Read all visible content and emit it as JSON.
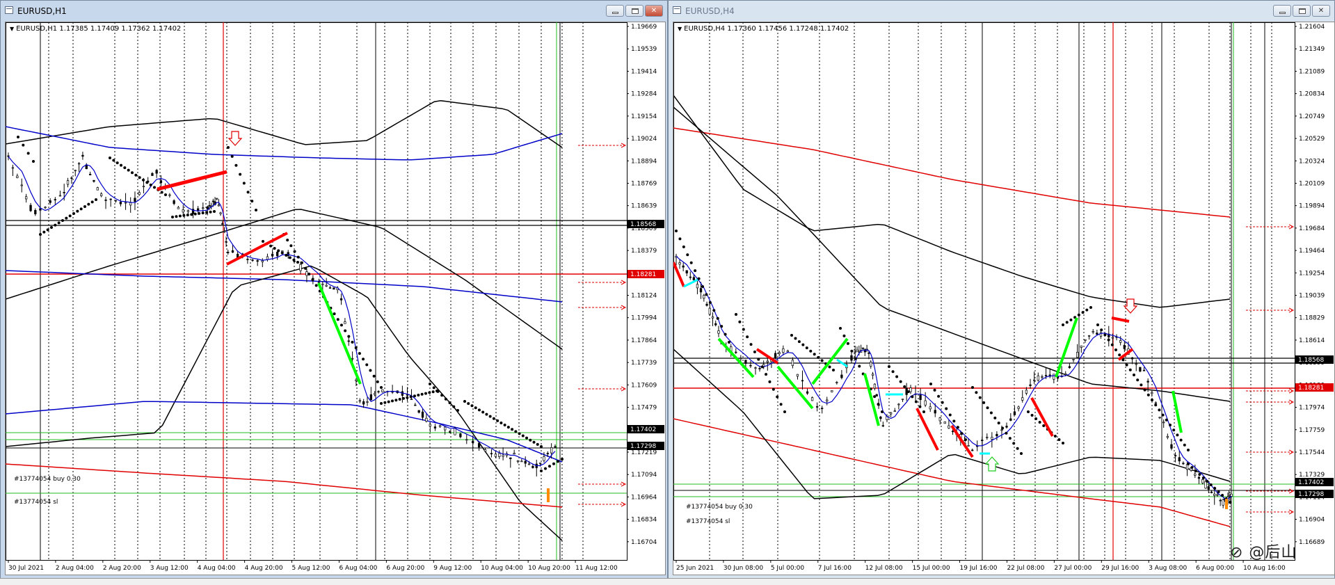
{
  "windows": [
    {
      "id": "left",
      "title": "EURUSD,H1",
      "info_text": "EURUSD,H1  1.17385 1.17409 1.17362 1.17402",
      "price_labels": [
        "1.19669",
        "1.19539",
        "1.19414",
        "1.19284",
        "1.19154",
        "1.19024",
        "1.18894",
        "1.18769",
        "1.18639",
        "1.18509",
        "1.18379",
        "1.18249",
        "1.18124",
        "1.17994",
        "1.17864",
        "1.17739",
        "1.17609",
        "1.17479",
        "1.17349",
        "1.17219",
        "1.17094",
        "1.16964",
        "1.16834",
        "1.16704"
      ],
      "time_labels": [
        "30 Jul 2021",
        "2 Aug 04:00",
        "2 Aug 20:00",
        "3 Aug 12:00",
        "4 Aug 04:00",
        "4 Aug 20:00",
        "5 Aug 12:00",
        "6 Aug 04:00",
        "6 Aug 20:00",
        "9 Aug 12:00",
        "10 Aug 04:00",
        "10 Aug 20:00",
        "11 Aug 12:00"
      ],
      "price_badges": [
        {
          "text": "1.18568",
          "color": "#000000",
          "text_color": "#ffffff"
        },
        {
          "text": "1.18281",
          "color": "#e00000",
          "text_color": "#ffffff"
        },
        {
          "text": "1.17402",
          "color": "#000000",
          "text_color": "#ffffff"
        },
        {
          "text": "1.17298",
          "color": "#000000",
          "text_color": "#ffffff"
        }
      ],
      "order_labels": [
        "#13774054 buy 0.30",
        "#13774054 sl"
      ],
      "state": "active"
    },
    {
      "id": "right",
      "title": "EURUSD,H4",
      "info_text": "EURUSD,H4  1.17360 1.17456 1.17248 1.17402",
      "price_labels": [
        "1.21604",
        "1.21349",
        "1.21089",
        "1.20834",
        "1.20749",
        "1.20529",
        "1.20324",
        "1.20109",
        "1.19894",
        "1.19684",
        "1.19464",
        "1.19254",
        "1.19039",
        "1.18829",
        "1.18614",
        "1.18399",
        "1.18189",
        "1.17974",
        "1.17759",
        "1.17544",
        "1.17329",
        "1.17114",
        "1.16904",
        "1.16689"
      ],
      "time_labels": [
        "25 Jun 2021",
        "30 Jun 08:00",
        "5 Jul 00:00",
        "7 Jul 16:00",
        "12 Jul 08:00",
        "15 Jul 00:00",
        "19 Jul 16:00",
        "22 Jul 08:00",
        "27 Jul 00:00",
        "29 Jul 16:00",
        "3 Aug 08:00",
        "6 Aug 00:00",
        "10 Aug 16:00"
      ],
      "price_badges": [
        {
          "text": "1.18568",
          "color": "#000000",
          "text_color": "#ffffff"
        },
        {
          "text": "1.18281",
          "color": "#e00000",
          "text_color": "#ffffff"
        },
        {
          "text": "1.17402",
          "color": "#000000",
          "text_color": "#ffffff"
        },
        {
          "text": "1.17298",
          "color": "#000000",
          "text_color": "#ffffff"
        }
      ],
      "order_labels": [
        "#13774054 buy 0.30",
        "#13774054 sl"
      ],
      "state": "inactive"
    }
  ],
  "watermark": "⊘ @后山",
  "colors": {
    "bear": "#ff0000",
    "bull": "#00ff00",
    "ma": "#0000c8",
    "bb": "#000000",
    "fib": "#ff0000",
    "grid": "#000000"
  }
}
